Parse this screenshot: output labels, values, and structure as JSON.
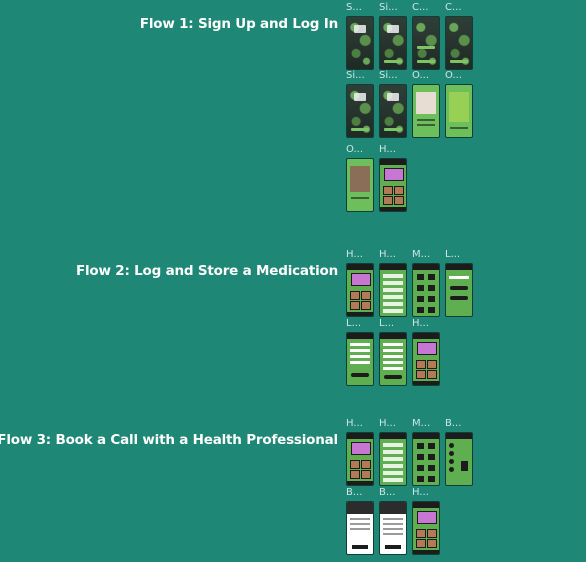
{
  "flows": [
    {
      "title": "Flow  1: Sign Up and Log In",
      "frames": [
        "S...",
        "Si...",
        "C...",
        "C...",
        "Si...",
        "Si...",
        "O...",
        "O...",
        "O...",
        "H..."
      ]
    },
    {
      "title": "Flow 2: Log and Store a Medication",
      "frames": [
        "H...",
        "H...",
        "M...",
        "L...",
        "L...",
        "L...",
        "H..."
      ]
    },
    {
      "title": "Flow 3: Book a Call with a Health Professional",
      "frames": [
        "H...",
        "H...",
        "M...",
        "B...",
        "B...",
        "B...",
        "H..."
      ]
    }
  ],
  "colors": {
    "background": "#1f8776",
    "title": "#ffffff",
    "frame_label": "#cfe6e1",
    "screen_green": "#6cbf5a",
    "screen_dark": "#2b3a33",
    "card_purple": "#c776d4"
  }
}
